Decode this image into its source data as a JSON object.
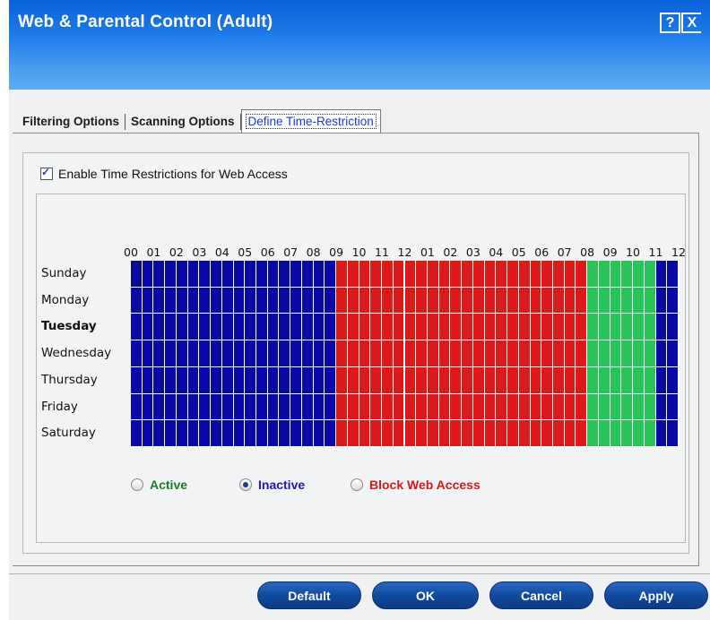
{
  "window": {
    "title": "Web & Parental Control (Adult)",
    "help_label": "?",
    "close_label": "X"
  },
  "tabs": [
    {
      "label": "Filtering Options"
    },
    {
      "label": "Scanning Options"
    },
    {
      "label": "Define Time-Restriction",
      "active": true
    }
  ],
  "enable_checkbox": {
    "label": "Enable Time Restrictions for Web Access",
    "checked": true
  },
  "hours": [
    "00",
    "01",
    "02",
    "03",
    "04",
    "05",
    "06",
    "07",
    "08",
    "09",
    "10",
    "11",
    "12",
    "01",
    "02",
    "03",
    "04",
    "05",
    "06",
    "07",
    "08",
    "09",
    "10",
    "11",
    "12"
  ],
  "days": [
    {
      "label": "Sunday",
      "bold": false
    },
    {
      "label": "Monday",
      "bold": false
    },
    {
      "label": "Tuesday",
      "bold": true
    },
    {
      "label": "Wednesday",
      "bold": false
    },
    {
      "label": "Thursday",
      "bold": false
    },
    {
      "label": "Friday",
      "bold": false
    },
    {
      "label": "Saturday",
      "bold": false
    }
  ],
  "schedule": {
    "segments_per_hour": 2,
    "total_hours": 24,
    "bands": [
      {
        "from_hour": 0,
        "to_hour": 9,
        "state": "inactive"
      },
      {
        "from_hour": 9,
        "to_hour": 20,
        "state": "block"
      },
      {
        "from_hour": 20,
        "to_hour": 23,
        "state": "active"
      },
      {
        "from_hour": 23,
        "to_hour": 24,
        "state": "inactive"
      }
    ],
    "colors": {
      "inactive": "#0a0aa8",
      "block": "#dc1818",
      "active": "#28c45a"
    }
  },
  "legend": {
    "active": {
      "label": "Active",
      "color": "#1d7a2f",
      "selected": false
    },
    "inactive": {
      "label": "Inactive",
      "color": "#1c1ab0",
      "selected": true
    },
    "block": {
      "label": "Block Web Access",
      "color": "#d61818",
      "selected": false
    }
  },
  "buttons": {
    "default": "Default",
    "ok": "OK",
    "cancel": "Cancel",
    "apply": "Apply"
  }
}
